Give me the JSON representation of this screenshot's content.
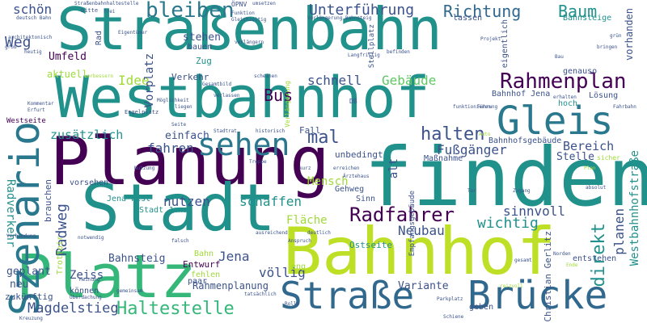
{
  "palette": {
    "purple": "#440154",
    "indigo": "#3b528b",
    "blue": "#31688e",
    "teal": "#21918c",
    "green": "#35b779",
    "lime": "#a0da39",
    "yellow": "#bddf26",
    "light": "#fde725"
  },
  "words": [
    {
      "text": "Straßenbahn",
      "color": "#21918c"
    },
    {
      "text": "Westbahnhof",
      "color": "#21918c"
    },
    {
      "text": "finden",
      "color": "#21918c"
    },
    {
      "text": "Planung",
      "color": "#440154"
    },
    {
      "text": "Stadt",
      "color": "#21918c"
    },
    {
      "text": "Bahnhof",
      "color": "#bddf26"
    },
    {
      "text": "Platz",
      "color": "#35b779"
    },
    {
      "text": "Gleis",
      "color": "#2a788e"
    },
    {
      "text": "Szenario",
      "color": "#2a788e"
    },
    {
      "text": "Straße",
      "color": "#31688e"
    },
    {
      "text": "Brücke",
      "color": "#31688e"
    },
    {
      "text": "Rahmenplan",
      "color": "#440154"
    },
    {
      "text": "sehen",
      "color": "#2a788e"
    },
    {
      "text": "bleiben",
      "color": "#2a788e"
    },
    {
      "text": "Radfahrer",
      "color": "#440154"
    },
    {
      "text": "Haltestelle",
      "color": "#35b779"
    },
    {
      "text": "Magdelstieg",
      "color": "#3b528b"
    },
    {
      "text": "Unterführung",
      "color": "#3b528b"
    },
    {
      "text": "Richtung",
      "color": "#31688e"
    },
    {
      "text": "Baum",
      "color": "#21918c"
    },
    {
      "text": "schön",
      "color": "#3b528b"
    },
    {
      "text": "Weg",
      "color": "#3b528b"
    },
    {
      "text": "Umfeld",
      "color": "#440154"
    },
    {
      "text": "Idee",
      "color": "#a0da39"
    },
    {
      "text": "Verkehr",
      "color": "#3b528b"
    },
    {
      "text": "Bus",
      "color": "#440154"
    },
    {
      "text": "schnell",
      "color": "#3b528b"
    },
    {
      "text": "Gebäude",
      "color": "#5ec962"
    },
    {
      "text": "mal",
      "color": "#3b528b"
    },
    {
      "text": "halten",
      "color": "#3b528b"
    },
    {
      "text": "Fußgänger",
      "color": "#3b528b"
    },
    {
      "text": "Bereich",
      "color": "#3b528b"
    },
    {
      "text": "Stelle",
      "color": "#3b528b"
    },
    {
      "text": "zusätzlich",
      "color": "#21918c"
    },
    {
      "text": "einfach",
      "color": "#3b528b"
    },
    {
      "text": "fahren",
      "color": "#3b528b"
    },
    {
      "text": "nutzen",
      "color": "#3b528b"
    },
    {
      "text": "schaffen",
      "color": "#21918c"
    },
    {
      "text": "Mensch",
      "color": "#a0da39"
    },
    {
      "text": "Radverkehr",
      "color": "#21918c"
    },
    {
      "text": "Radweg",
      "color": "#3b528b"
    },
    {
      "text": "Fläche",
      "color": "#a0da39"
    },
    {
      "text": "Neubau",
      "color": "#3b528b"
    },
    {
      "text": "wichtig",
      "color": "#21918c"
    },
    {
      "text": "sinnvoll",
      "color": "#3b528b"
    },
    {
      "text": "direkt",
      "color": "#21918c"
    },
    {
      "text": "planen",
      "color": "#3b528b"
    },
    {
      "text": "Westbahnhofstraße",
      "color": "#21918c"
    },
    {
      "text": "Jena",
      "color": "#3b528b"
    },
    {
      "text": "Zeiss",
      "color": "#3b528b"
    },
    {
      "text": "Bahnsteig",
      "color": "#3b528b"
    },
    {
      "text": "Entwurf",
      "color": "#440154"
    },
    {
      "text": "völlig",
      "color": "#3b528b"
    },
    {
      "text": "Ostseite",
      "color": "#21918c"
    },
    {
      "text": "Variante",
      "color": "#3b528b"
    },
    {
      "text": "Rahmenplanung",
      "color": "#3b528b"
    },
    {
      "text": "geplant",
      "color": "#3b528b"
    },
    {
      "text": "neu",
      "color": "#3b528b"
    },
    {
      "text": "zukünftig",
      "color": "#3b528b"
    },
    {
      "text": "stehen",
      "color": "#3b528b"
    },
    {
      "text": "bauen",
      "color": "#3b528b"
    },
    {
      "text": "Vorplatz",
      "color": "#3b528b"
    },
    {
      "text": "Zug",
      "color": "#21918c"
    },
    {
      "text": "aktuell",
      "color": "#a0da39"
    },
    {
      "text": "Westseite",
      "color": "#440154"
    },
    {
      "text": "Lösung",
      "color": "#3b528b"
    },
    {
      "text": "hoch",
      "color": "#21918c"
    },
    {
      "text": "Fall",
      "color": "#3b528b"
    },
    {
      "text": "unbedingt",
      "color": "#3b528b"
    },
    {
      "text": "Maßnahme",
      "color": "#3b528b"
    },
    {
      "text": "alt",
      "color": "#3b528b"
    },
    {
      "text": "Gehweg",
      "color": "#3b528b"
    },
    {
      "text": "Sinn",
      "color": "#3b528b"
    },
    {
      "text": "vorsehen",
      "color": "#3b528b"
    },
    {
      "text": "brauchen",
      "color": "#3b528b"
    },
    {
      "text": "Jena West",
      "color": "#21918c"
    },
    {
      "text": "Stadt Jena",
      "color": "#21918c"
    },
    {
      "text": "Bahnhofsgebäude",
      "color": "#3b528b"
    },
    {
      "text": "Bahnsteige",
      "color": "#21918c"
    },
    {
      "text": "lassen",
      "color": "#3b528b"
    },
    {
      "text": "eigentlich",
      "color": "#3b528b"
    },
    {
      "text": "vorhanden",
      "color": "#3b528b"
    },
    {
      "text": "genauso",
      "color": "#3b528b"
    },
    {
      "text": "Bahnhof Jena",
      "color": "#3b528b"
    },
    {
      "text": "können",
      "color": "#3b528b"
    },
    {
      "text": "Christian Gerlitz",
      "color": "#3b528b"
    },
    {
      "text": "geben",
      "color": "#3b528b"
    },
    {
      "text": "paar",
      "color": "#3b528b"
    },
    {
      "text": "fehlen",
      "color": "#a0da39"
    },
    {
      "text": "Bahn",
      "color": "#a0da39"
    },
    {
      "text": "entstehen",
      "color": "#3b528b"
    },
    {
      "text": "Engelplatz",
      "color": "#3b528b"
    },
    {
      "text": "ÖPNV",
      "color": "#3b528b"
    },
    {
      "text": "bitte",
      "color": "#3b528b"
    },
    {
      "text": "Rad",
      "color": "#3b528b"
    },
    {
      "text": "Stellplatz",
      "color": "#3b528b"
    },
    {
      "text": "Empfangsgebäude",
      "color": "#3b528b"
    },
    {
      "text": "Trottoir",
      "color": "#a0da39"
    },
    {
      "text": "Straßenbahnhaltestelle",
      "color": "#3b528b"
    },
    {
      "text": "frei",
      "color": "#3b528b"
    },
    {
      "text": "deutsch Bahn",
      "color": "#3b528b"
    },
    {
      "text": "architektonisch",
      "color": "#3b528b"
    },
    {
      "text": "Verlängerung Bahnsteig",
      "color": "#3b528b"
    },
    {
      "text": "Funktion",
      "color": "#3b528b"
    },
    {
      "text": "Gleichzeitig",
      "color": "#3b528b"
    },
    {
      "text": "umsetzen",
      "color": "#3b528b"
    },
    {
      "text": "Projekt",
      "color": "#3b528b"
    },
    {
      "text": "verbessern",
      "color": "#a0da39"
    },
    {
      "text": "groß",
      "color": "#3b528b"
    },
    {
      "text": "Erfurt",
      "color": "#3b528b"
    },
    {
      "text": "Kommentar",
      "color": "#3b528b"
    },
    {
      "text": "Möglichkeit",
      "color": "#3b528b"
    },
    {
      "text": "historisch",
      "color": "#3b528b"
    },
    {
      "text": "Verlängerung",
      "color": "#a0da39"
    },
    {
      "text": "Führung",
      "color": "#3b528b"
    },
    {
      "text": "DB",
      "color": "#3b528b"
    },
    {
      "text": "Ärztehaus",
      "color": "#3b528b"
    },
    {
      "text": "Auto",
      "color": "#a0da39"
    },
    {
      "text": "Anspruch",
      "color": "#3b528b"
    },
    {
      "text": "deutlich",
      "color": "#3b528b"
    },
    {
      "text": "Parkplatz",
      "color": "#3b528b"
    },
    {
      "text": "gesamt",
      "color": "#3b528b"
    },
    {
      "text": "Norden",
      "color": "#3b528b"
    },
    {
      "text": "Ende",
      "color": "#a0da39"
    },
    {
      "text": "absolut",
      "color": "#3b528b"
    },
    {
      "text": "Fahrbahn",
      "color": "#3b528b"
    },
    {
      "text": "sicher",
      "color": "#a0da39"
    },
    {
      "text": "grün",
      "color": "#3b528b"
    },
    {
      "text": "Bau",
      "color": "#3b528b"
    },
    {
      "text": "bringen",
      "color": "#3b528b"
    },
    {
      "text": "erhalten",
      "color": "#3b528b"
    },
    {
      "text": "Plan",
      "color": "#a0da39"
    },
    {
      "text": "Zugang",
      "color": "#3b528b"
    },
    {
      "text": "Tor",
      "color": "#3b528b"
    },
    {
      "text": "erreichen",
      "color": "#3b528b"
    },
    {
      "text": "Treppe",
      "color": "#3b528b"
    },
    {
      "text": "falsch",
      "color": "#3b528b"
    },
    {
      "text": "Verbindung",
      "color": "#3b528b"
    },
    {
      "text": "Meinung",
      "color": "#3b528b"
    },
    {
      "text": "Überdachung",
      "color": "#3b528b"
    },
    {
      "text": "tatsächlich",
      "color": "#3b528b"
    },
    {
      "text": "eng",
      "color": "#a0da39"
    },
    {
      "text": "kurz",
      "color": "#3b528b"
    },
    {
      "text": "Langfristig",
      "color": "#3b528b"
    },
    {
      "text": "befinden",
      "color": "#3b528b"
    },
    {
      "text": "Eigentümer",
      "color": "#3b528b"
    },
    {
      "text": "heutig",
      "color": "#3b528b"
    },
    {
      "text": "scheinen",
      "color": "#3b528b"
    },
    {
      "text": "liegen",
      "color": "#3b528b"
    },
    {
      "text": "Seite",
      "color": "#3b528b"
    },
    {
      "text": "Nutzung",
      "color": "#3b528b"
    },
    {
      "text": "Stadtrat",
      "color": "#3b528b"
    },
    {
      "text": "verlängern",
      "color": "#3b528b"
    },
    {
      "text": "Gesamtbild",
      "color": "#3b528b"
    },
    {
      "text": "ausreichend",
      "color": "#3b528b"
    },
    {
      "text": "notwendig",
      "color": "#3b528b"
    },
    {
      "text": "gemeinsam",
      "color": "#3b528b"
    },
    {
      "text": "Schiene",
      "color": "#3b528b"
    },
    {
      "text": "Rolle",
      "color": "#3b528b"
    },
    {
      "text": "funktionieren",
      "color": "#3b528b"
    },
    {
      "text": "reizvoll",
      "color": "#a0da39"
    },
    {
      "text": "verlassen",
      "color": "#3b528b"
    },
    {
      "text": "Kreuzung",
      "color": "#3b528b"
    }
  ]
}
